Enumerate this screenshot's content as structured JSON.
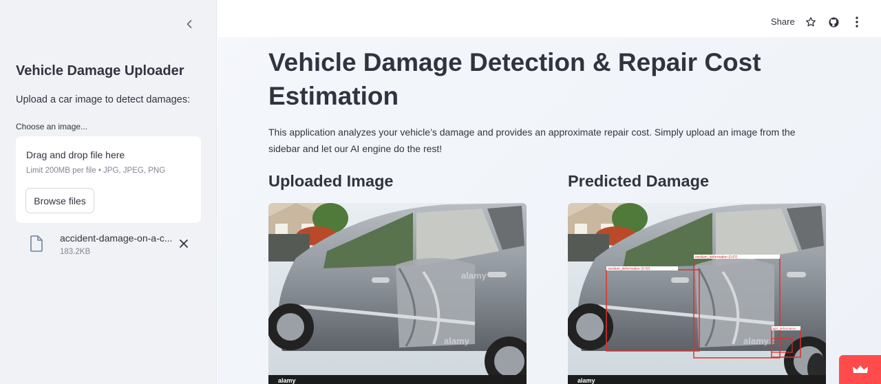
{
  "sidebar": {
    "title": "Vehicle Damage Uploader",
    "subtitle": "Upload a car image to detect damages:",
    "uploader_label": "Choose an image...",
    "dropzone_title": "Drag and drop file here",
    "dropzone_limit": "Limit 200MB per file • JPG, JPEG, PNG",
    "browse_label": "Browse files",
    "file": {
      "name": "accident-damage-on-a-c...",
      "size": "183.2KB"
    }
  },
  "toolbar": {
    "share_label": "Share"
  },
  "main": {
    "title": "Vehicle Damage Detection & Repair Cost Estimation",
    "intro": "This application analyzes your vehicle’s damage and provides an approximate repair cost. Simply upload an image from the sidebar and let our AI engine do the rest!",
    "uploaded_heading": "Uploaded Image",
    "predicted_heading": "Predicted Damage",
    "watermark": "alamy",
    "detections": [
      {
        "label": "medium_deformation (0.92)"
      },
      {
        "label": "medium_deformation (0.87)"
      },
      {
        "label": "light_deformation"
      },
      {
        "label": "light_scratch"
      }
    ]
  },
  "colors": {
    "accent": "#ff4b4b",
    "detection_box": "#e0302a",
    "sidebar_bg": "#f0f2f6"
  }
}
